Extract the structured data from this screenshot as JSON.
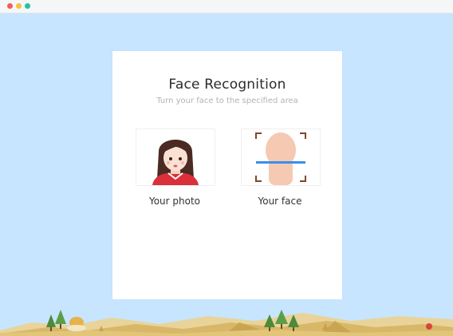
{
  "window": {
    "controls": [
      "close",
      "minimize",
      "maximize"
    ]
  },
  "card": {
    "title": "Face Recognition",
    "subtitle": "Turn your face to the specified area",
    "photo_label": "Your photo",
    "face_label": "Your face"
  },
  "icons": {
    "photo": "user-portrait-icon",
    "face": "face-scan-icon"
  },
  "colors": {
    "background": "#c7e5ff",
    "card": "#ffffff",
    "scan_line": "#3b8ee8",
    "scan_corners": "#7a4a2a"
  }
}
